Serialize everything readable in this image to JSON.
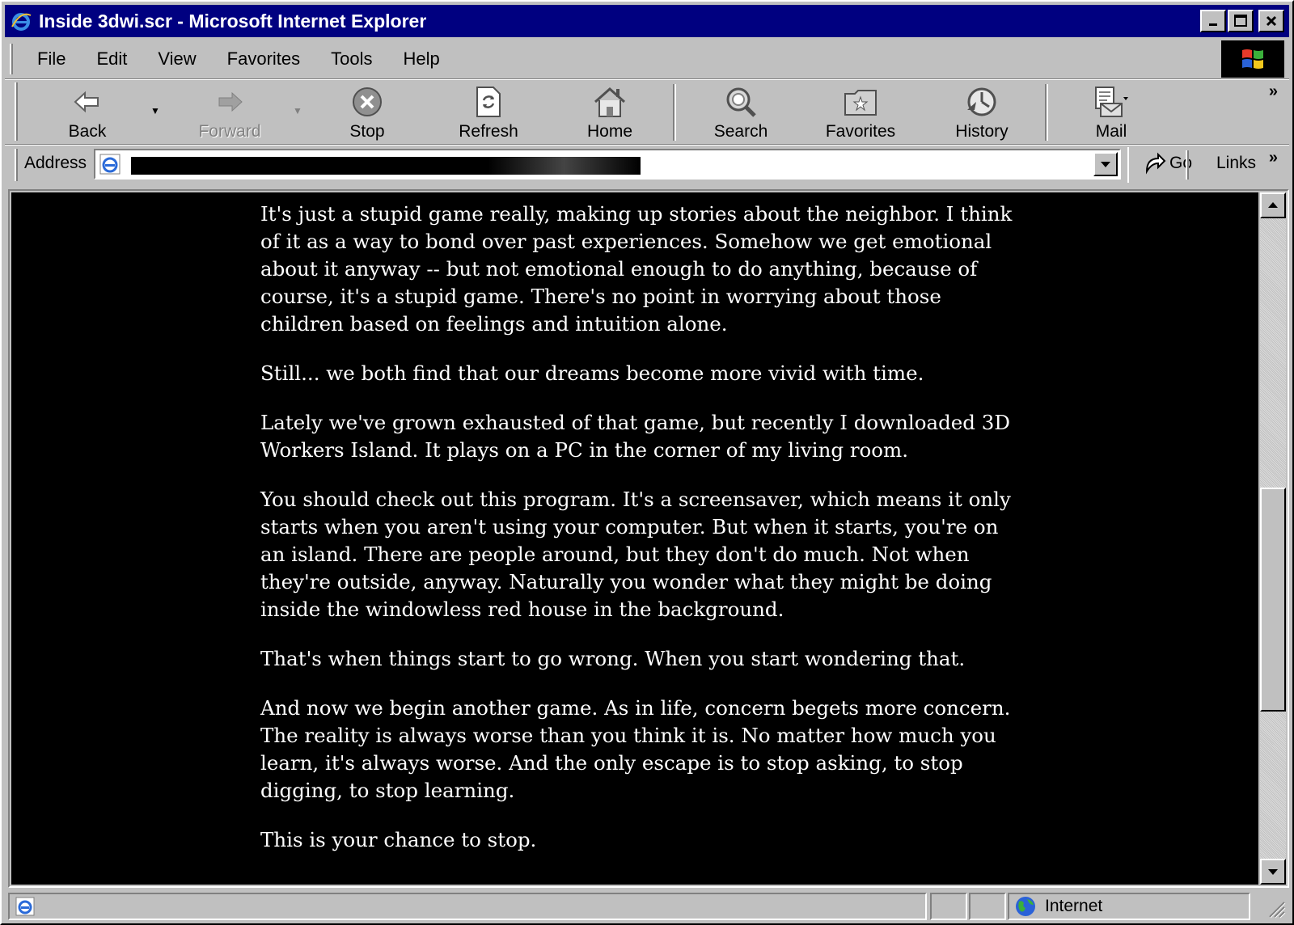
{
  "window": {
    "title": "Inside 3dwi.scr - Microsoft Internet Explorer"
  },
  "menu": {
    "items": [
      "File",
      "Edit",
      "View",
      "Favorites",
      "Tools",
      "Help"
    ]
  },
  "toolbar": {
    "back": "Back",
    "forward": "Forward",
    "stop": "Stop",
    "refresh": "Refresh",
    "home": "Home",
    "search": "Search",
    "favorites": "Favorites",
    "history": "History",
    "mail": "Mail"
  },
  "address": {
    "label": "Address",
    "go": "Go",
    "links": "Links"
  },
  "content": {
    "paragraphs": [
      "It's just a stupid game really, making up stories about the neighbor. I think of it as a way to bond over past experiences. Somehow we get emotional about it anyway -- but not emotional enough to do anything, because of course, it's a stupid game. There's no point in worrying about those children based on feelings and intuition alone.",
      "Still... we both find that our dreams become more vivid with time.",
      "Lately we've grown exhausted of that game, but recently I downloaded 3D Workers Island. It plays on a PC in the corner of my living room.",
      "You should check out this program. It's a screensaver, which means it only starts when you aren't using your computer. But when it starts, you're on an island. There are people around, but they don't do much. Not when they're outside, anyway. Naturally you wonder what they might be doing inside the windowless red house in the background.",
      "That's when things start to go wrong. When you start wondering that.",
      "And now we begin another game. As in life, concern begets more concern. The reality is always worse than you think it is. No matter how much you learn, it's always worse. And the only escape is to stop asking, to stop digging, to stop learning.",
      "This is your chance to stop."
    ]
  },
  "status": {
    "zone": "Internet"
  },
  "scrollbar": {
    "position_fraction": 0.42,
    "visible_fraction": 0.35
  }
}
